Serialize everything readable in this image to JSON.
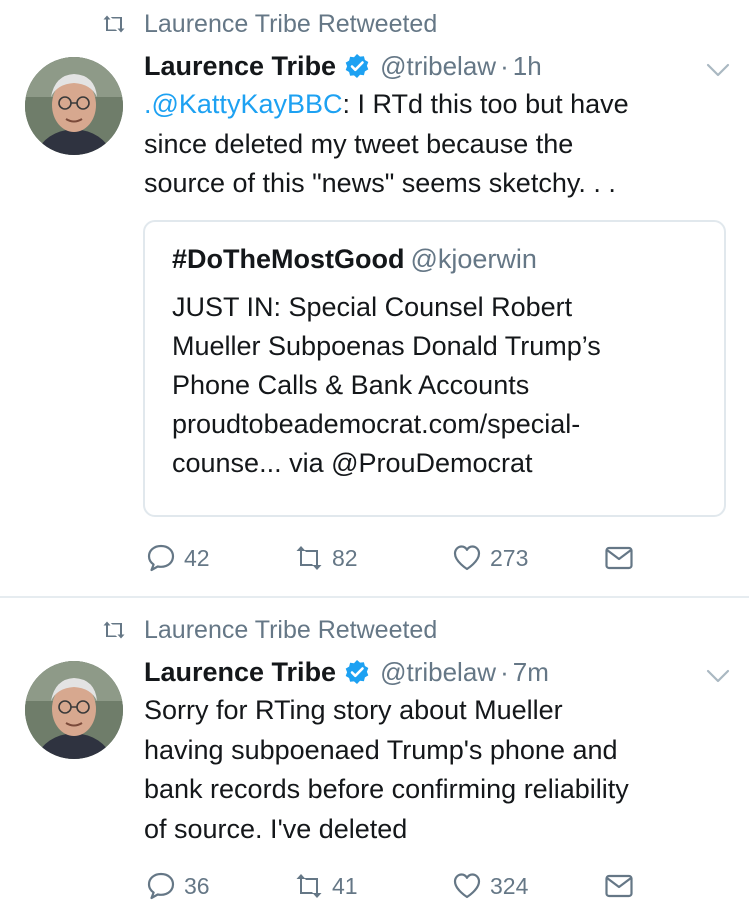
{
  "tweets": [
    {
      "retweeted_by": "Laurence Tribe Retweeted",
      "author_name": "Laurence Tribe",
      "handle": "@tribelaw",
      "time": "1h",
      "text": {
        "mention": ".@KattyKayBBC",
        "line1_rest": ": I RTd this too but have",
        "line2": "since deleted my tweet because the",
        "line3": "source of this \"news\" seems sketchy. . ."
      },
      "quote": {
        "name": "#DoTheMostGood",
        "handle": "@kjoerwin",
        "lines": [
          "JUST IN: Special Counsel Robert",
          "Mueller Subpoenas Donald Trump’s",
          "Phone Calls & Bank Accounts",
          "proudtobeademocrat.com/special-",
          "counse... via @ProuDemocrat"
        ]
      },
      "actions": {
        "replies": "42",
        "retweets": "82",
        "likes": "273"
      }
    },
    {
      "retweeted_by": "Laurence Tribe Retweeted",
      "author_name": "Laurence Tribe",
      "handle": "@tribelaw",
      "time": "7m",
      "text": {
        "lines": [
          "Sorry for RTing story about Mueller",
          "having subpoenaed Trump's phone and",
          "bank records before confirming reliability",
          "of source. I've deleted"
        ]
      },
      "actions": {
        "replies": "36",
        "retweets": "41",
        "likes": "324"
      }
    }
  ],
  "icons": {
    "retweet": "retweet-icon",
    "verified": "verified-badge-icon",
    "menu": "chevron-down-icon",
    "reply": "reply-icon",
    "like": "heart-icon",
    "dm": "envelope-icon"
  },
  "colors": {
    "text": "#14171a",
    "secondary": "#657786",
    "link": "#1da1f2",
    "verified": "#1da1f2",
    "border": "#e1e8ed"
  }
}
